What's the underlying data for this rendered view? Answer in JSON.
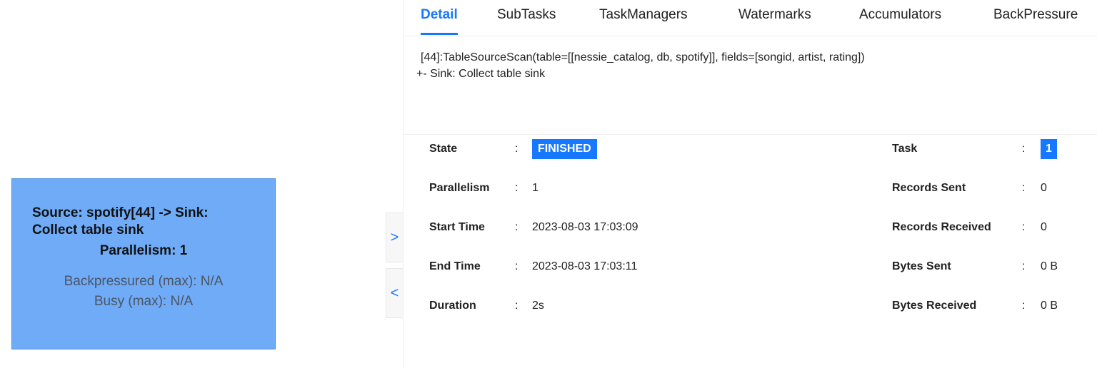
{
  "graph": {
    "node": {
      "title": "Source: spotify[44] -> Sink: Collect table sink",
      "parallelism": "Parallelism: 1",
      "backpressured": "Backpressured (max): N/A",
      "busy": "Busy (max): N/A",
      "color": "#6fabf7"
    },
    "expand_icon": ">",
    "collapse_icon": "<"
  },
  "tabs": [
    "Detail",
    "SubTasks",
    "TaskManagers",
    "Watermarks",
    "Accumulators",
    "BackPressure"
  ],
  "active_tab": "Detail",
  "plan": {
    "line1": "[44]:TableSourceScan(table=[[nessie_catalog, db, spotify]], fields=[songid, artist, rating])",
    "line2": "+- Sink: Collect table sink"
  },
  "details": {
    "left": [
      {
        "label": "State",
        "value": "FINISHED"
      },
      {
        "label": "Parallelism",
        "value": "1"
      },
      {
        "label": "Start Time",
        "value": "2023-08-03 17:03:09"
      },
      {
        "label": "End Time",
        "value": "2023-08-03 17:03:11"
      },
      {
        "label": "Duration",
        "value": "2s"
      }
    ],
    "right": [
      {
        "label": "Task",
        "value": "1"
      },
      {
        "label": "Records Sent",
        "value": "0"
      },
      {
        "label": "Records Received",
        "value": "0"
      },
      {
        "label": "Bytes Sent",
        "value": "0 B"
      },
      {
        "label": "Bytes Received",
        "value": "0 B"
      }
    ],
    "colon": ":"
  },
  "colors": {
    "accent": "#1677ff",
    "status_finished": "#1677ff"
  }
}
